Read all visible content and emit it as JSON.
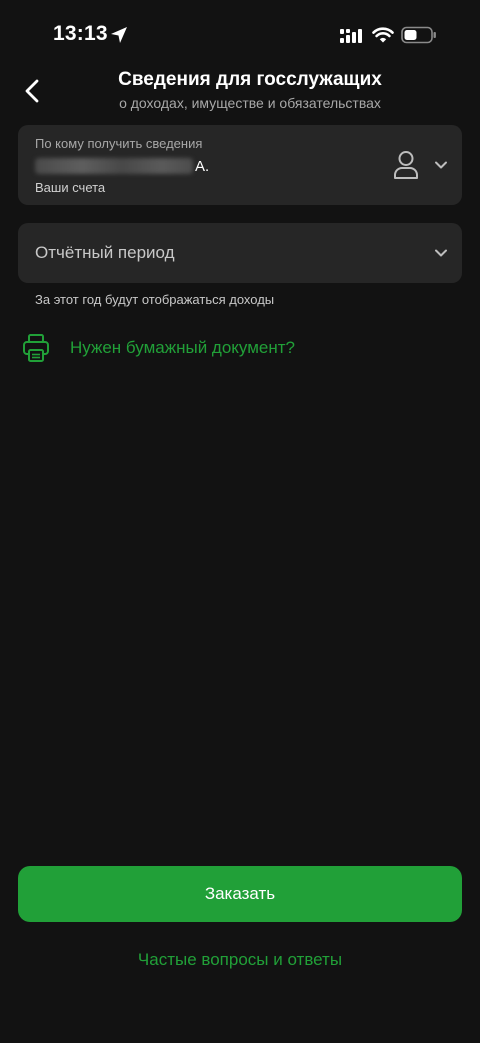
{
  "status_bar": {
    "time": "13:13",
    "icons": [
      "location-arrow-icon",
      "cellular-signal-icon",
      "wifi-icon",
      "battery-icon"
    ]
  },
  "header": {
    "back_icon": "chevron-left-icon",
    "title": "Сведения для госслужащих",
    "subtitle": "о доходах, имуществе и обязательствах"
  },
  "recipient": {
    "label": "По кому получить сведения",
    "name_suffix": "А.",
    "account": "Ваши счета",
    "icon": "person-icon"
  },
  "period": {
    "label": "Отчётный период",
    "hint": "За этот год будут отображаться доходы"
  },
  "paper_document": {
    "icon": "printer-icon",
    "label": "Нужен бумажный документ?"
  },
  "actions": {
    "order_label": "Заказать",
    "faq_label": "Частые вопросы и ответы"
  },
  "colors": {
    "background": "#121212",
    "card": "#262626",
    "accent": "#21a038",
    "text_primary": "#ffffff",
    "text_secondary": "#a8a8a8"
  }
}
